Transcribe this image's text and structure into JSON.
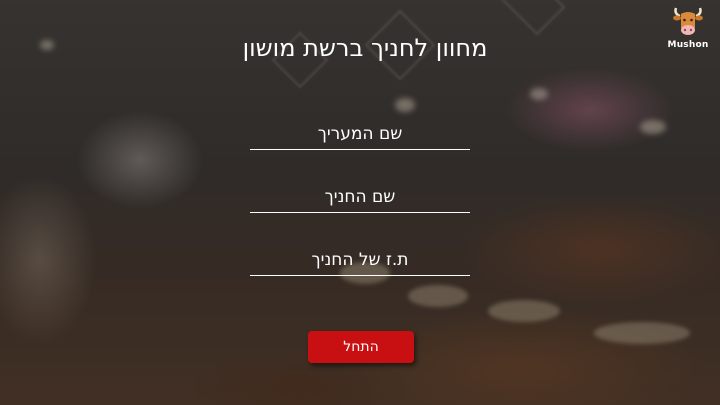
{
  "page": {
    "title": "מחוון לחניך ברשת מושון"
  },
  "logo": {
    "text": "Mushon",
    "icon": "cow-head-icon"
  },
  "form": {
    "evaluator_name_placeholder": "שם המעריך",
    "trainee_name_placeholder": "שם החניך",
    "trainee_id_placeholder": "ת.ז של החניך",
    "evaluator_name_value": "",
    "trainee_name_value": "",
    "trainee_id_value": ""
  },
  "actions": {
    "start_label": "התחל"
  },
  "colors": {
    "accent": "#c80f12",
    "text": "#ffffff"
  }
}
